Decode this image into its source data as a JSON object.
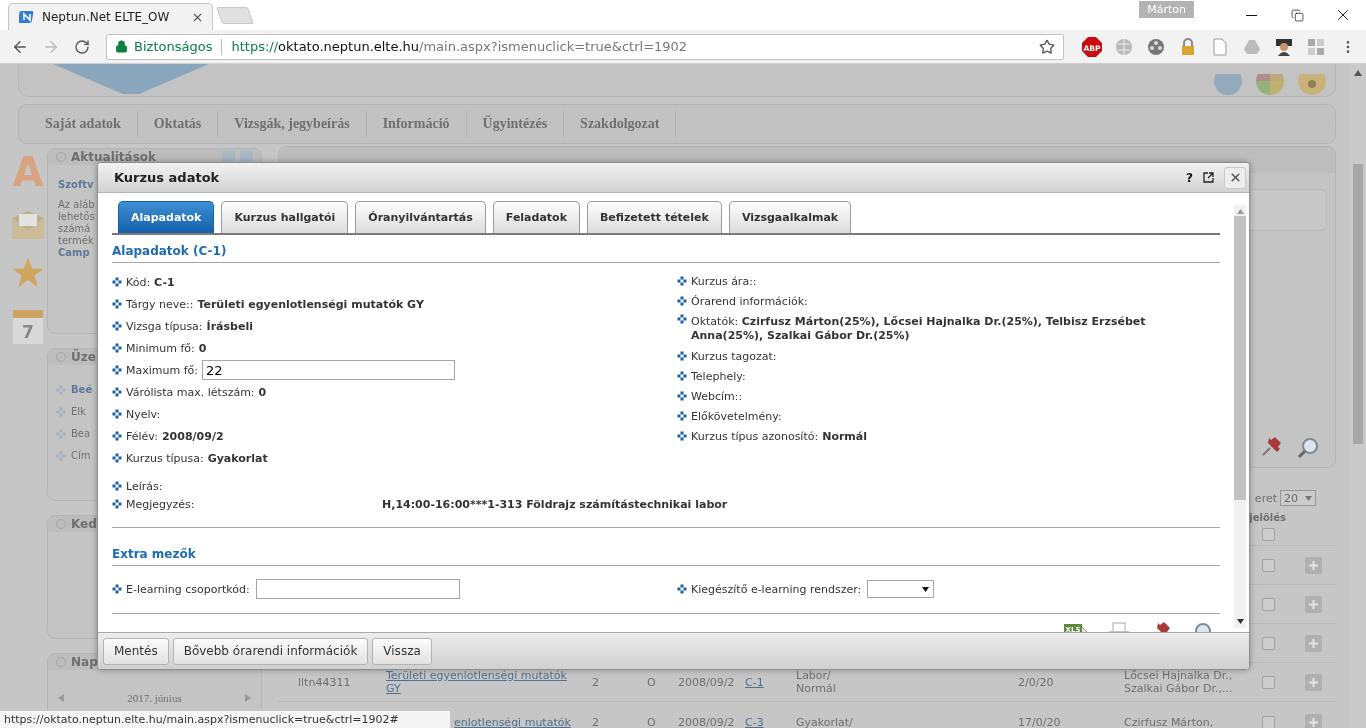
{
  "browser": {
    "tab_title": "Neptun.Net ELTE_OW",
    "profile": "Márton",
    "secure_label": "Biztonságos",
    "url_scheme": "https://",
    "url_host": "oktato.neptun.elte.hu",
    "url_path": "/main.aspx?ismenuclick=true&ctrl=1902",
    "extensions": [
      {
        "kind": "abp",
        "label": "ABP"
      },
      {
        "kind": "globe"
      },
      {
        "kind": "film"
      },
      {
        "kind": "lock"
      },
      {
        "kind": "page"
      },
      {
        "kind": "drive"
      },
      {
        "kind": "figure"
      },
      {
        "kind": "puzzle"
      }
    ]
  },
  "banner_icons": [
    {
      "kind": "globe"
    },
    {
      "kind": "pie"
    },
    {
      "kind": "round"
    }
  ],
  "menu": [
    "Saját adatok",
    "Oktatás",
    "Vizsgák, jegybeírás",
    "Információ",
    "Ügyintézés",
    "Szakdolgozat"
  ],
  "side_icons": [
    {
      "kind": "letter",
      "label": "A"
    },
    {
      "kind": "mail"
    },
    {
      "kind": "star"
    },
    {
      "kind": "calendar",
      "label": "7"
    }
  ],
  "sidebar": [
    {
      "title": "Aktualitások",
      "tools": true,
      "lines": [
        {
          "kind": "heading",
          "text": "Szoftv"
        },
        {
          "kind": "text",
          "text": "Az aláb"
        },
        {
          "kind": "text",
          "text": "lehetős"
        },
        {
          "kind": "text",
          "text": "számá"
        },
        {
          "kind": "text",
          "text": "termék"
        },
        {
          "kind": "heading",
          "text": "Camp"
        }
      ]
    },
    {
      "title": "Üze",
      "lines": [
        {
          "kind": "bullet_strong",
          "text": "Beé"
        },
        {
          "kind": "bullet",
          "text": "Elk"
        },
        {
          "kind": "bullet",
          "text": "Bea"
        },
        {
          "kind": "bullet",
          "text": "Cím"
        }
      ]
    },
    {
      "title": "Ked"
    },
    {
      "title": "Nap",
      "calendar": "2017. június"
    }
  ],
  "pager": {
    "label": "eret",
    "size": "20"
  },
  "table": {
    "header": "jelölés",
    "header_checked": false,
    "rows": [
      {
        "checked": false
      },
      {
        "checked": false
      },
      {
        "checked": false
      },
      {
        "checked": false,
        "cells": {
          "id": "lltn44311",
          "course": "Területi egyenlotlenségi mutatók GY",
          "column_3": "2",
          "column_4": "O",
          "semester": "2008/09/2",
          "code": "C-1",
          "type": [
            "Labor/",
            "Normál"
          ],
          "count": "2/0/20",
          "teachers": [
            "Lőcsei Hajnalka Dr.,",
            "Szalkai Gábor Dr.,..."
          ]
        }
      },
      {
        "checked": false,
        "cells": {
          "course": "enlotlenségi mutatók",
          "column_3": "2",
          "column_4": "O",
          "semester": "2008/09/2",
          "code": "C-3",
          "type": [
            "Gyakorlat/"
          ],
          "count": "17/0/20",
          "teachers": [
            "Czirfusz Márton,"
          ]
        }
      }
    ]
  },
  "dialog": {
    "title": "Kurzus adatok",
    "help": "?",
    "tabs": [
      {
        "label": "Alapadatok",
        "selected": true
      },
      {
        "label": "Kurzus hallgatói",
        "selected": false
      },
      {
        "label": "Óranyilvántartás",
        "selected": false
      },
      {
        "label": "Feladatok",
        "selected": false
      },
      {
        "label": "Befizetett tételek",
        "selected": false
      },
      {
        "label": "Vizsgaalkalmak",
        "selected": false
      }
    ],
    "section": "Alapadatok (C-1)",
    "left_fields": [
      {
        "kind": "text",
        "label": "Kód:",
        "value": "C-1"
      },
      {
        "kind": "text",
        "label": "Tárgy neve::",
        "value": "Területi egyenlotlenségi mutatók GY"
      },
      {
        "kind": "text",
        "label": "Vizsga típusa:",
        "value": "Írásbeli"
      },
      {
        "kind": "text",
        "label": "Minimum fő:",
        "value": "0"
      },
      {
        "kind": "input",
        "label": "Maximum fő:",
        "value": "22"
      },
      {
        "kind": "text",
        "label": "Várólista max. létszám:",
        "value": "0"
      },
      {
        "kind": "text",
        "label": "Nyelv:"
      },
      {
        "kind": "text",
        "label": "Félév:",
        "value": "2008/09/2"
      },
      {
        "kind": "text",
        "label": "Kurzus típusa:",
        "value": "Gyakorlat"
      }
    ],
    "right_fields": [
      {
        "label": "Kurzus ára::"
      },
      {
        "label": "Órarend információk:"
      },
      {
        "label": "Oktatók:",
        "value": "Czirfusz Márton(25%), Lőcsei Hajnalka Dr.(25%), Telbisz Erzsébet Anna(25%), Szalkai Gábor Dr.(25%)"
      },
      {
        "label": "Kurzus tagozat:"
      },
      {
        "label": "Telephely:"
      },
      {
        "label": "Webcím::"
      },
      {
        "label": "Előkövetelmény:"
      },
      {
        "label": "Kurzus típus azonosító:",
        "value": "Normál"
      }
    ],
    "notes": [
      {
        "label": "Leírás:"
      },
      {
        "label": "Megjegyzés:",
        "value": "H,14:00-16:00***1-313 Földrajz számítástechnikai labor"
      }
    ],
    "extra_title": "Extra mezők",
    "extra_fields": [
      {
        "kind": "input",
        "label": "E-learning csoportkód:"
      },
      {
        "kind": "select",
        "label": "Kiegészítő e-learning rendszer:"
      }
    ],
    "export_icons": [
      {
        "kind": "xls",
        "label": "XLS"
      },
      {
        "kind": "print"
      },
      {
        "kind": "pin"
      },
      {
        "kind": "search"
      }
    ],
    "buttons": [
      "Mentés",
      "Bővebb órarendi információk",
      "Vissza"
    ]
  },
  "status_url": "https://oktato.neptun.elte.hu/main.aspx?ismenuclick=true&ctrl=1902#"
}
